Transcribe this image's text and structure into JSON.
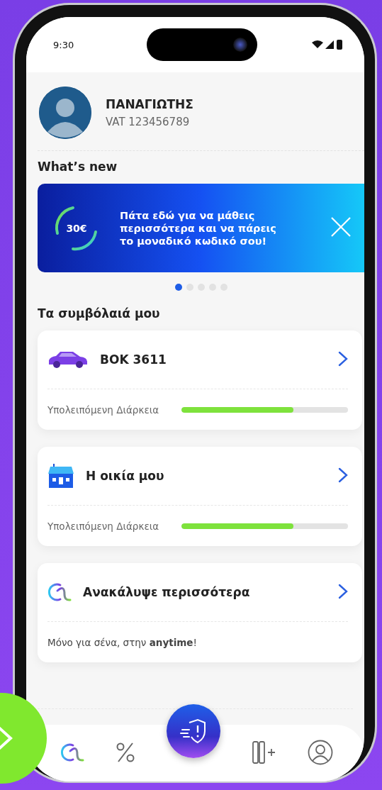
{
  "status_bar": {
    "time": "9:30"
  },
  "profile": {
    "name": "ΠΑΝΑΓΙΩΤΗΣ",
    "vat": "VAT 123456789"
  },
  "whats_new": {
    "title": "What’s new",
    "banner": {
      "amount": "30€",
      "text": "Πάτα εδώ για να μάθεις περισσότερα και να πάρεις το μοναδικό κωδικό σου!"
    },
    "dots": [
      {
        "selected": true
      },
      {
        "selected": false
      },
      {
        "selected": false
      },
      {
        "selected": false
      },
      {
        "selected": false
      }
    ]
  },
  "contracts": {
    "title": "Τα συμβόλαιά μου",
    "cards": [
      {
        "kind": "car",
        "title": "ΒΟΚ 3611",
        "label": "Υπολειπόμενη Διάρκεια",
        "level": 0.67
      },
      {
        "kind": "home",
        "title": "Η οικία μου",
        "label": "Υπολειπόμενη Διάρκεια",
        "level": 0.67
      },
      {
        "kind": "discover",
        "title": "Ανακάλυψε περισσότερα",
        "subtitle": "Μόνο για σένα, στην **anytime**!"
      }
    ]
  },
  "bottom_nav": {
    "items": [
      {
        "kind": "logo"
      },
      {
        "kind": "percent"
      },
      {
        "kind": "fab"
      },
      {
        "kind": "add-card"
      },
      {
        "kind": "profile"
      }
    ]
  }
}
